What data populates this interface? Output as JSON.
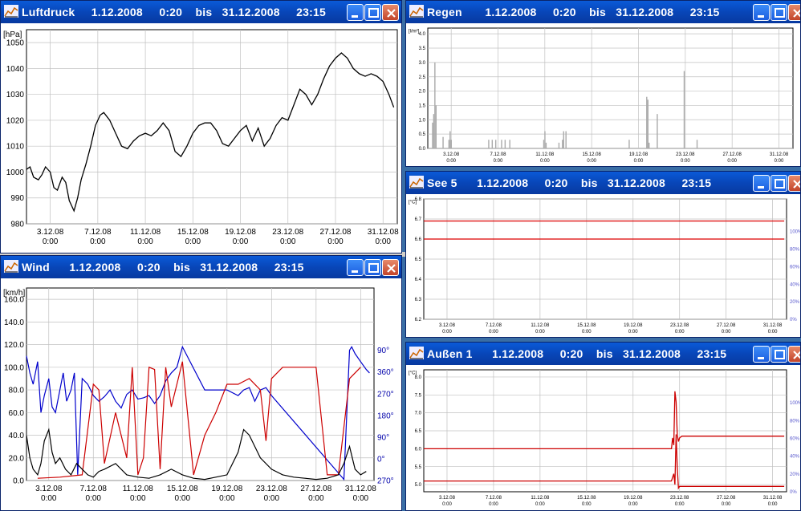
{
  "windows": {
    "luftdruck": {
      "title": "Luftdruck     1.12.2008     0:20    bis   31.12.2008     23:15",
      "colors": {
        "title_bg": "#0846b8",
        "close": "#c2442a"
      }
    },
    "wind": {
      "title": "Wind      1.12.2008     0:20    bis   31.12.2008     23:15"
    },
    "regen": {
      "title": "Regen       1.12.2008     0:20    bis   31.12.2008     23:15"
    },
    "see5": {
      "title": "See 5      1.12.2008     0:20    bis   31.12.2008     23:15"
    },
    "aussen1": {
      "title": "Außen 1      1.12.2008     0:20    bis   31.12.2008     23:15"
    }
  },
  "chart_data": [
    {
      "id": "luftdruck",
      "type": "line",
      "ylabel": "[hPa]",
      "ylim": [
        980,
        1055
      ],
      "yticks": [
        "1050",
        "1040",
        "1030",
        "1020",
        "1010",
        "1000",
        "990",
        "980"
      ],
      "xticks": [
        [
          "3.12.08",
          "0:00"
        ],
        [
          "7.12.08",
          "0:00"
        ],
        [
          "11.12.08",
          "0:00"
        ],
        [
          "15.12.08",
          "0:00"
        ],
        [
          "19.12.08",
          "0:00"
        ],
        [
          "23.12.08",
          "0:00"
        ],
        [
          "27.12.08",
          "0:00"
        ],
        [
          "31.12.08",
          "0:00"
        ]
      ],
      "grid": true,
      "series": [
        {
          "color": "#000000",
          "x": [
            1.0,
            1.3,
            1.6,
            2.0,
            2.3,
            2.6,
            3.0,
            3.3,
            3.6,
            4.0,
            4.3,
            4.6,
            5.0,
            5.3,
            5.6,
            6.0,
            6.4,
            6.8,
            7.2,
            7.5,
            8.0,
            8.5,
            9.0,
            9.5,
            10.0,
            10.5,
            11.0,
            11.5,
            12.0,
            12.5,
            13.0,
            13.5,
            14.0,
            14.5,
            15.0,
            15.5,
            16.0,
            16.5,
            17.0,
            17.5,
            18.0,
            18.5,
            19.0,
            19.5,
            20.0,
            20.5,
            21.0,
            21.5,
            22.0,
            22.5,
            23.0,
            23.5,
            24.0,
            24.5,
            25.0,
            25.5,
            26.0,
            26.5,
            27.0,
            27.5,
            28.0,
            28.5,
            29.0,
            29.5,
            30.0,
            30.5,
            31.0,
            31.5,
            31.9
          ],
          "y": [
            1001,
            1002,
            998,
            997,
            999,
            1002,
            1000,
            994,
            993,
            998,
            996,
            989,
            985,
            990,
            997,
            1003,
            1010,
            1018,
            1022,
            1023,
            1020,
            1015,
            1010,
            1009,
            1012,
            1014,
            1015,
            1014,
            1016,
            1019,
            1016,
            1008,
            1006,
            1010,
            1015,
            1018,
            1019,
            1019,
            1016,
            1011,
            1010,
            1013,
            1016,
            1018,
            1012,
            1017,
            1010,
            1013,
            1018,
            1021,
            1020,
            1026,
            1032,
            1030,
            1026,
            1030,
            1036,
            1041,
            1044,
            1046,
            1044,
            1040,
            1038,
            1037,
            1038,
            1037,
            1035,
            1030,
            1025
          ]
        }
      ]
    },
    {
      "id": "wind",
      "type": "line",
      "ylabel": "[km/h]",
      "ylim": [
        0,
        170
      ],
      "yticks": [
        "160.0",
        "140.0",
        "120.0",
        "100.0",
        "80.0",
        "60.0",
        "40.0",
        "20.0",
        "0.0"
      ],
      "y2ticks": [
        "90°",
        "360°",
        "270°",
        "180°",
        "90°",
        "0°",
        "270°"
      ],
      "xticks": [
        [
          "3.12.08",
          "0:00"
        ],
        [
          "7.12.08",
          "0:00"
        ],
        [
          "11.12.08",
          "0:00"
        ],
        [
          "15.12.08",
          "0:00"
        ],
        [
          "19.12.08",
          "0:00"
        ],
        [
          "23.12.08",
          "0:00"
        ],
        [
          "27.12.08",
          "0:00"
        ],
        [
          "31.12.08",
          "0:00"
        ]
      ],
      "grid": true,
      "series": [
        {
          "color": "#0000cc",
          "x": [
            1.0,
            1.3,
            1.6,
            2.0,
            2.3,
            2.6,
            3.0,
            3.3,
            3.6,
            4.0,
            4.3,
            4.6,
            5.0,
            5.3,
            5.6,
            6.0,
            6.5,
            7.0,
            7.5,
            8.0,
            8.5,
            9.0,
            9.5,
            10.0,
            10.5,
            11.0,
            11.5,
            12.0,
            12.5,
            13.0,
            13.5,
            14.0,
            14.5,
            15.0,
            17.0,
            18.0,
            19.0,
            20.0,
            20.5,
            21.0,
            21.5,
            22.0,
            22.5,
            23.0,
            29.5,
            30.0,
            30.2,
            30.5,
            31.0,
            31.5,
            31.8
          ],
          "y": [
            110,
            95,
            85,
            105,
            60,
            75,
            90,
            65,
            60,
            80,
            95,
            70,
            80,
            95,
            5,
            90,
            85,
            75,
            70,
            74,
            80,
            70,
            64,
            76,
            80,
            72,
            73,
            75,
            68,
            75,
            88,
            95,
            100,
            118,
            80,
            80,
            80,
            75,
            80,
            82,
            70,
            80,
            82,
            75,
            1,
            115,
            118,
            112,
            105,
            98,
            95
          ]
        },
        {
          "color": "#cc0000",
          "x": [
            2.0,
            4.0,
            6.0,
            7.0,
            7.5,
            8.0,
            9.0,
            10.0,
            10.5,
            11.0,
            11.5,
            12.0,
            12.5,
            13.0,
            13.5,
            14.0,
            14.5,
            15.0,
            16.0,
            17.0,
            18.0,
            19.0,
            20.0,
            21.0,
            22.0,
            22.5,
            23.0,
            24.0,
            25.0,
            26.0,
            27.0,
            28.0,
            29.0,
            30.0,
            31.0
          ],
          "y": [
            2,
            3,
            5,
            85,
            80,
            15,
            60,
            20,
            100,
            5,
            20,
            100,
            98,
            10,
            100,
            65,
            85,
            105,
            5,
            40,
            60,
            85,
            85,
            90,
            80,
            35,
            90,
            100,
            100,
            100,
            100,
            5,
            5,
            90,
            100
          ]
        },
        {
          "color": "#000000",
          "x": [
            1.0,
            1.3,
            1.6,
            2.0,
            2.3,
            2.6,
            3.0,
            3.3,
            3.6,
            4.0,
            4.5,
            5.0,
            5.5,
            6.0,
            6.5,
            7.0,
            7.5,
            8.0,
            9.0,
            10.0,
            11.0,
            12.0,
            13.0,
            14.0,
            15.0,
            16.0,
            17.0,
            18.0,
            19.0,
            20.0,
            20.5,
            21.0,
            21.5,
            22.0,
            23.0,
            24.0,
            25.0,
            26.0,
            27.0,
            28.0,
            29.0,
            29.5,
            30.0,
            30.5,
            31.0,
            31.5
          ],
          "y": [
            40,
            20,
            10,
            5,
            15,
            35,
            45,
            25,
            15,
            20,
            10,
            5,
            15,
            10,
            5,
            3,
            8,
            10,
            15,
            5,
            3,
            2,
            5,
            10,
            5,
            2,
            1,
            3,
            5,
            25,
            45,
            40,
            30,
            20,
            10,
            5,
            3,
            2,
            1,
            2,
            5,
            15,
            30,
            10,
            5,
            8
          ]
        }
      ]
    },
    {
      "id": "regen",
      "type": "bar",
      "ylabel": "[l/m²]",
      "ylim": [
        0,
        4.2
      ],
      "yticks": [
        "4.0",
        "3.5",
        "3.0",
        "2.5",
        "2.0",
        "1.5",
        "1.0",
        "0.5",
        "0.0"
      ],
      "xticks": [
        [
          "3.12.08",
          "0:00"
        ],
        [
          "7.12.08",
          "0:00"
        ],
        [
          "11.12.08",
          "0:00"
        ],
        [
          "15.12.08",
          "0:00"
        ],
        [
          "19.12.08",
          "0:00"
        ],
        [
          "23.12.08",
          "0:00"
        ],
        [
          "27.12.08",
          "0:00"
        ],
        [
          "31.12.08",
          "0:00"
        ]
      ],
      "grid": true,
      "series": [
        {
          "color": "#aaaaaa",
          "x": [
            1.4,
            1.5,
            1.6,
            1.7,
            2.3,
            2.8,
            2.9,
            3.0,
            6.2,
            6.5,
            6.8,
            7.3,
            7.6,
            8.0,
            10.9,
            11.0,
            11.1,
            12.2,
            12.5,
            12.6,
            12.8,
            18.2,
            19.7,
            19.8,
            19.9,
            20.6,
            22.9,
            24.0
          ],
          "values": [
            0.9,
            1.2,
            3.0,
            1.5,
            0.4,
            0.3,
            0.6,
            0.3,
            0.3,
            0.3,
            0.3,
            0.3,
            0.3,
            0.3,
            0.3,
            0.6,
            0.2,
            0.2,
            0.3,
            0.6,
            0.6,
            0.3,
            1.8,
            1.7,
            0.2,
            1.2,
            2.7,
            0.3
          ]
        }
      ]
    },
    {
      "id": "see5",
      "type": "line",
      "ylabel": "[°C]",
      "ylim": [
        6.2,
        6.8
      ],
      "yticks": [
        "6.8",
        "6.7",
        "6.6",
        "6.5",
        "6.4",
        "6.3",
        "6.2"
      ],
      "y2ticks": [
        "100%",
        "80%",
        "60%",
        "40%",
        "20%",
        "0%"
      ],
      "xticks": [
        [
          "3.12.08",
          "0:00"
        ],
        [
          "7.12.08",
          "0:00"
        ],
        [
          "11.12.08",
          "0:00"
        ],
        [
          "15.12.08",
          "0:00"
        ],
        [
          "19.12.08",
          "0:00"
        ],
        [
          "23.12.08",
          "0:00"
        ],
        [
          "27.12.08",
          "0:00"
        ],
        [
          "31.12.08",
          "0:00"
        ]
      ],
      "grid": true,
      "series": [
        {
          "color": "#dd0000",
          "x": [
            1.0,
            32.0
          ],
          "y": [
            6.69,
            6.69
          ]
        },
        {
          "color": "#dd0000",
          "x": [
            1.0,
            32.0
          ],
          "y": [
            6.6,
            6.6
          ]
        }
      ]
    },
    {
      "id": "aussen1",
      "type": "line",
      "ylabel": "[°C]",
      "ylim": [
        4.8,
        8.2
      ],
      "yticks": [
        "8.0",
        "7.5",
        "7.0",
        "6.5",
        "6.0",
        "5.5",
        "5.0"
      ],
      "y2ticks": [
        "100%",
        "80%",
        "60%",
        "40%",
        "20%",
        "0%"
      ],
      "xticks": [
        [
          "3.12.08",
          "0:00"
        ],
        [
          "7.12.08",
          "0:00"
        ],
        [
          "11.12.08",
          "0:00"
        ],
        [
          "15.12.08",
          "0:00"
        ],
        [
          "19.12.08",
          "0:00"
        ],
        [
          "23.12.08",
          "0:00"
        ],
        [
          "27.12.08",
          "0:00"
        ],
        [
          "31.12.08",
          "0:00"
        ]
      ],
      "grid": true,
      "series": [
        {
          "color": "#cc0000",
          "x": [
            1.0,
            22.3,
            22.4,
            22.5,
            22.6,
            22.7,
            22.8,
            22.9,
            23.0,
            23.2,
            32.0
          ],
          "y": [
            6.0,
            6.0,
            6.3,
            6.1,
            7.6,
            7.3,
            6.4,
            6.2,
            6.3,
            6.35,
            6.35
          ]
        },
        {
          "color": "#cc0000",
          "x": [
            1.0,
            22.3,
            22.4,
            22.5,
            22.6,
            22.7,
            22.8,
            22.9,
            23.0,
            32.0
          ],
          "y": [
            5.1,
            5.1,
            5.2,
            5.3,
            5.0,
            6.4,
            5.5,
            4.9,
            4.95,
            4.95
          ]
        }
      ]
    }
  ]
}
